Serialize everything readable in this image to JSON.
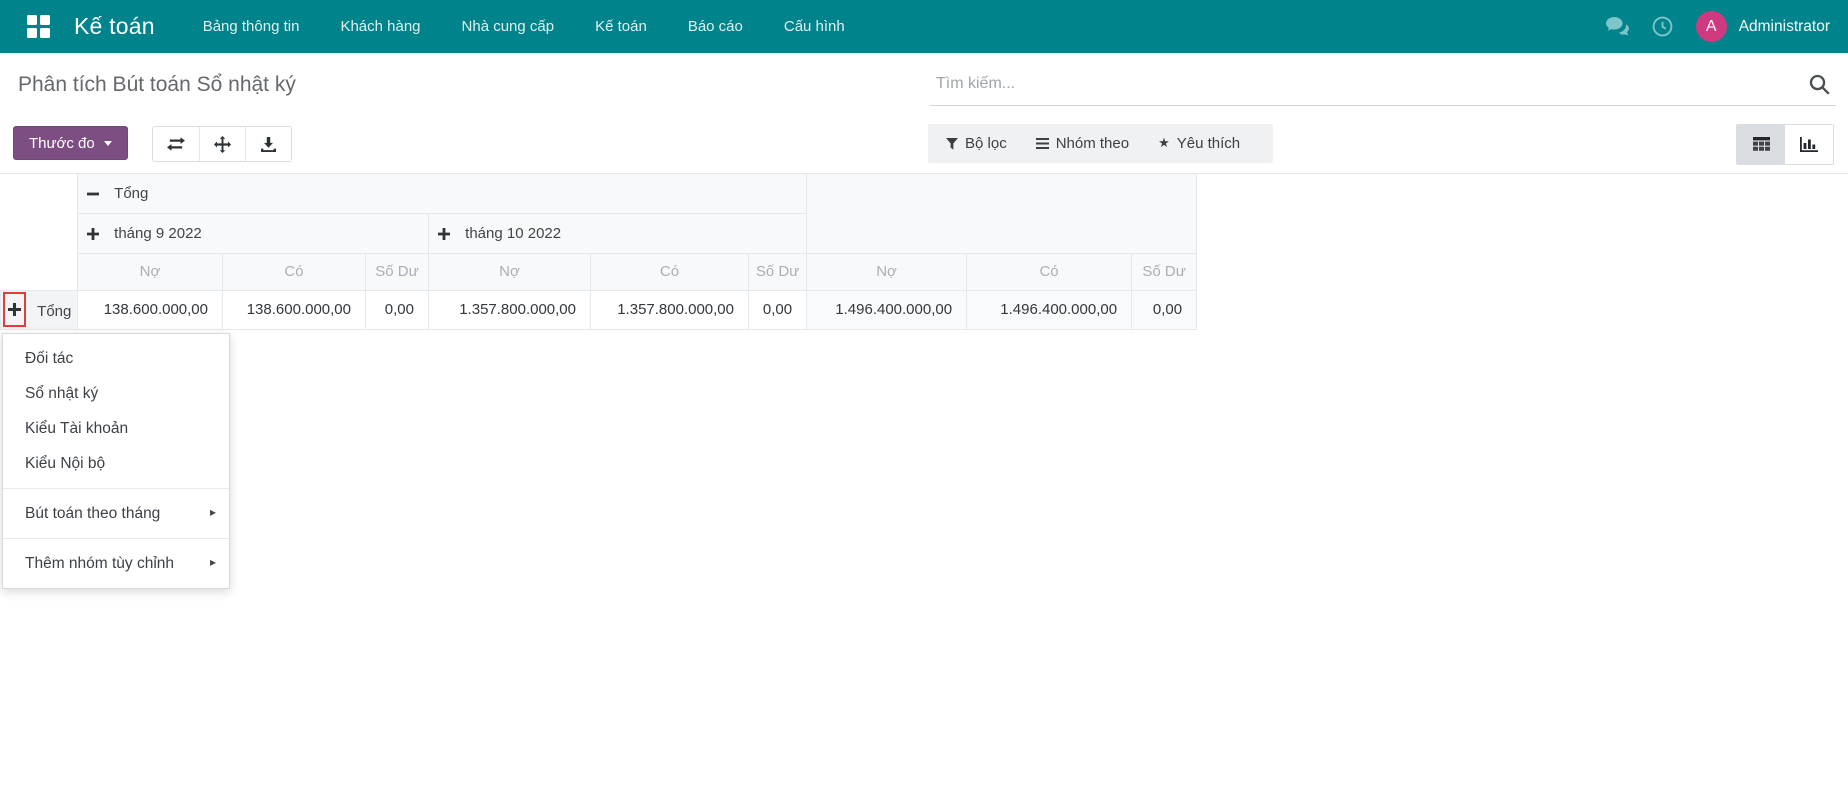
{
  "navbar": {
    "app_name": "Kế toán",
    "menu_items": [
      "Bảng thông tin",
      "Khách hàng",
      "Nhà cung cấp",
      "Kế toán",
      "Báo cáo",
      "Cấu hình"
    ],
    "icons": [
      "apps-grid-icon",
      "chat-icon",
      "clock-icon"
    ],
    "avatar_initial": "A",
    "user_name": "Administrator"
  },
  "control_panel": {
    "title": "Phân tích Bút toán Sổ nhật ký",
    "measure_button_label": "Thước đo",
    "tool_icons": [
      "flip-axis-icon",
      "expand-all-icon",
      "download-icon"
    ],
    "search_placeholder": "Tìm kiếm...",
    "filters": {
      "filter_label": "Bộ lọc",
      "groupby_label": "Nhóm theo",
      "favorite_label": "Yêu thích"
    },
    "view_switcher": [
      "pivot-view-icon",
      "bar-chart-view-icon"
    ]
  },
  "pivot": {
    "top_header": "Tổng",
    "col_groups": [
      "tháng 9 2022",
      "tháng 10 2022"
    ],
    "measure_row": [
      "Nợ",
      "Có",
      "Số Dư",
      "Nợ",
      "Có",
      "Số Dư",
      "Nợ",
      "Có",
      "Số Dư"
    ],
    "row": {
      "label": "Tổng",
      "values": [
        "138.600.000,00",
        "138.600.000,00",
        "0,00",
        "1.357.800.000,00",
        "1.357.800.000,00",
        "0,00",
        "1.496.400.000,00",
        "1.496.400.000,00",
        "0,00"
      ]
    }
  },
  "dropdown": {
    "items": [
      "Đối tác",
      "Sổ nhật ký",
      "Kiểu Tài khoản",
      "Kiểu Nội bộ"
    ],
    "submenu_items": [
      "Bút toán theo tháng",
      "Thêm nhóm tùy chỉnh"
    ]
  },
  "colors": {
    "navbar_bg": "#00838a",
    "primary_button": "#7d4e82",
    "avatar_bg": "#cd3a80",
    "click_highlight": "#e23c38"
  }
}
